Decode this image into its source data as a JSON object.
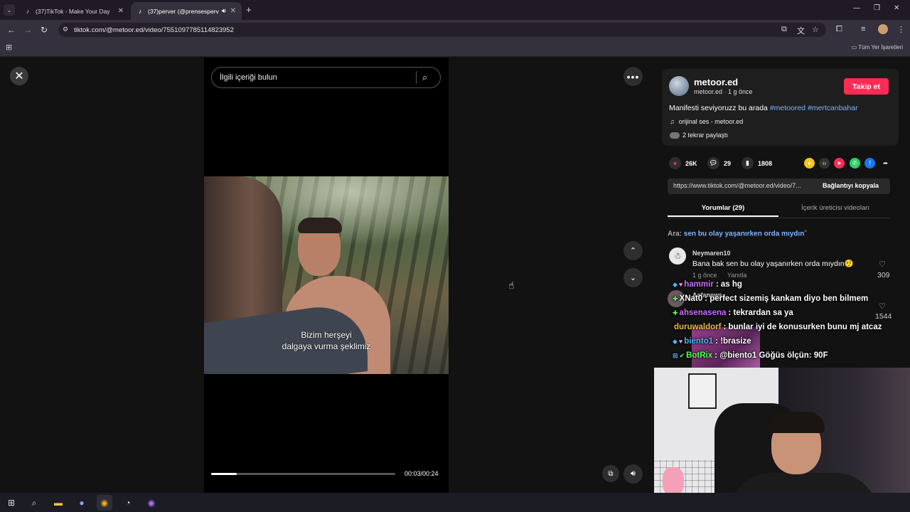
{
  "browser": {
    "tabs": [
      {
        "title": "(37)TikTok - Make Your Day",
        "favicon": "tiktok-icon"
      },
      {
        "title": "(37)perver (@prensesperve",
        "favicon": "tiktok-icon",
        "audio_icon": "speaker-icon"
      }
    ],
    "url": "tiktok.com/@metoor.ed/video/7551097785114823952",
    "bookmarks_label": "Tüm Yer İşaretleri"
  },
  "video": {
    "search_placeholder": "İlgili içeriği bulun",
    "subtitle_line1": "Bizim herşeyi",
    "subtitle_line2": "dalgaya vurma şeklimiz",
    "time": "00:03/00:24",
    "progress": 0.14
  },
  "author": {
    "name": "metoor.ed",
    "sub": "metoor.ed · 1 g önce",
    "follow_label": "Takip et",
    "desc_text": "Manifesti seviyoruzz bu arada",
    "tags": [
      "#metoored",
      "#mertcanbahar"
    ],
    "sound": "orijinal ses - metoor.ed",
    "reposts": "2 tekrar paylaştı"
  },
  "stats": {
    "likes": "26K",
    "comments": "29",
    "saves": "1808"
  },
  "share": {
    "link": "https://www.tiktok.com/@metoor.ed/video/7...",
    "copy_label": "Bağlantıyı kopyala"
  },
  "tabs": {
    "comments": "Yorumlar (29)",
    "creator_videos": "İçerik üreticisi videoları"
  },
  "search_suggestion": {
    "prefix": "Ara:",
    "query": "sen bu olay yaşanırken orda mıydın"
  },
  "comments": [
    {
      "user": "Neymaren10",
      "text": "Bana bak sen bu olay yaşanırken orda mıydın🤨",
      "time": "1 g önce",
      "reply": "Yanıtla",
      "likes": "309"
    },
    {
      "user": "Asfanews",
      "likes": "1544"
    }
  ],
  "stream_chat": [
    {
      "user": "hammir",
      "text": "as hg",
      "color": "#c86bff"
    },
    {
      "user": "XNat0",
      "text": "perfect sizemiş kankam diyo ben bilmem",
      "color": "#ffffff"
    },
    {
      "user": "ahsenasena",
      "text": "tekrardan sa ya",
      "color": "#d06bff"
    },
    {
      "user": "duruwaldorf",
      "text": "bunlar iyi de konusurken bunu mj atcaz",
      "color": "#e6b84a"
    },
    {
      "user": "biento1",
      "text": "!brasize",
      "color": "#4fb3ff"
    },
    {
      "user": "BotRix",
      "text": "@biento1 Göğüs ölçün: 90F",
      "color": "#5cff5c"
    }
  ],
  "colors": {
    "accent": "#fe2c55",
    "hashtag": "#7db4ff"
  }
}
